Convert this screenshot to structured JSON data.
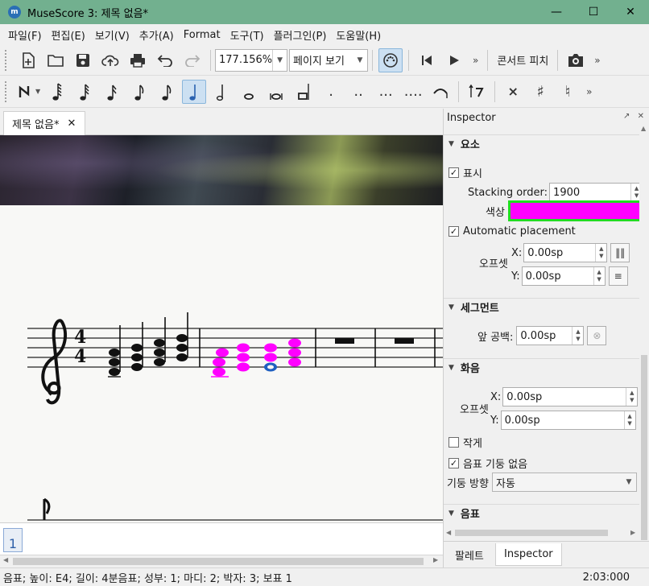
{
  "window": {
    "title": "MuseScore 3: 제목 없음*",
    "app_icon": "musescore-icon",
    "controls": [
      "minimize-icon",
      "maximize-icon",
      "close-icon"
    ]
  },
  "menu": [
    "파일(F)",
    "편집(E)",
    "보기(V)",
    "추가(A)",
    "Format",
    "도구(T)",
    "플러그인(P)",
    "도움말(H)"
  ],
  "toolbar1": {
    "zoom": "177.156%",
    "view_mode": "페이지 보기",
    "concert_pitch": "콘서트 피치",
    "more": "»"
  },
  "toolbar2": {
    "more": "»",
    "voice_more": "»"
  },
  "document_tab": {
    "label": "제목 없음*",
    "close": "✕"
  },
  "score": {
    "time_signature": {
      "numerator": "4",
      "denominator": "4"
    },
    "highlight_color": "#ff00ff",
    "selected_note_color": "#2060c0"
  },
  "navigator": {
    "page": "1"
  },
  "inspector": {
    "title": "Inspector",
    "element": {
      "header": "요소",
      "visible_label": "표시",
      "visible": true,
      "stacking_label": "Stacking order:",
      "stacking_value": "1900",
      "color_label": "색상",
      "color_value": "#ff00ff",
      "auto_place_label": "Automatic placement",
      "auto_place": true,
      "offset_label": "오프셋",
      "x_label": "X:",
      "x_value": "0.00sp",
      "y_label": "Y:",
      "y_value": "0.00sp"
    },
    "segment": {
      "header": "세그먼트",
      "leading_label": "앞 공백:",
      "leading_value": "0.00sp"
    },
    "chord": {
      "header": "화음",
      "offset_label": "오프셋",
      "x_label": "X:",
      "x_value": "0.00sp",
      "y_label": "Y:",
      "y_value": "0.00sp",
      "small_label": "작게",
      "small": false,
      "no_stem_label": "음표 기둥 없음",
      "no_stem": true,
      "stem_dir_label": "기둥 방향",
      "stem_dir_value": "자동"
    },
    "note": {
      "header": "음표"
    },
    "tabs": [
      "팔레트",
      "Inspector"
    ]
  },
  "status": {
    "text": "음표; 높이: E4; 길이: 4분음표; 성부: 1;  마디: 2; 박자: 3; 보표 1",
    "time": "2:03:000"
  }
}
